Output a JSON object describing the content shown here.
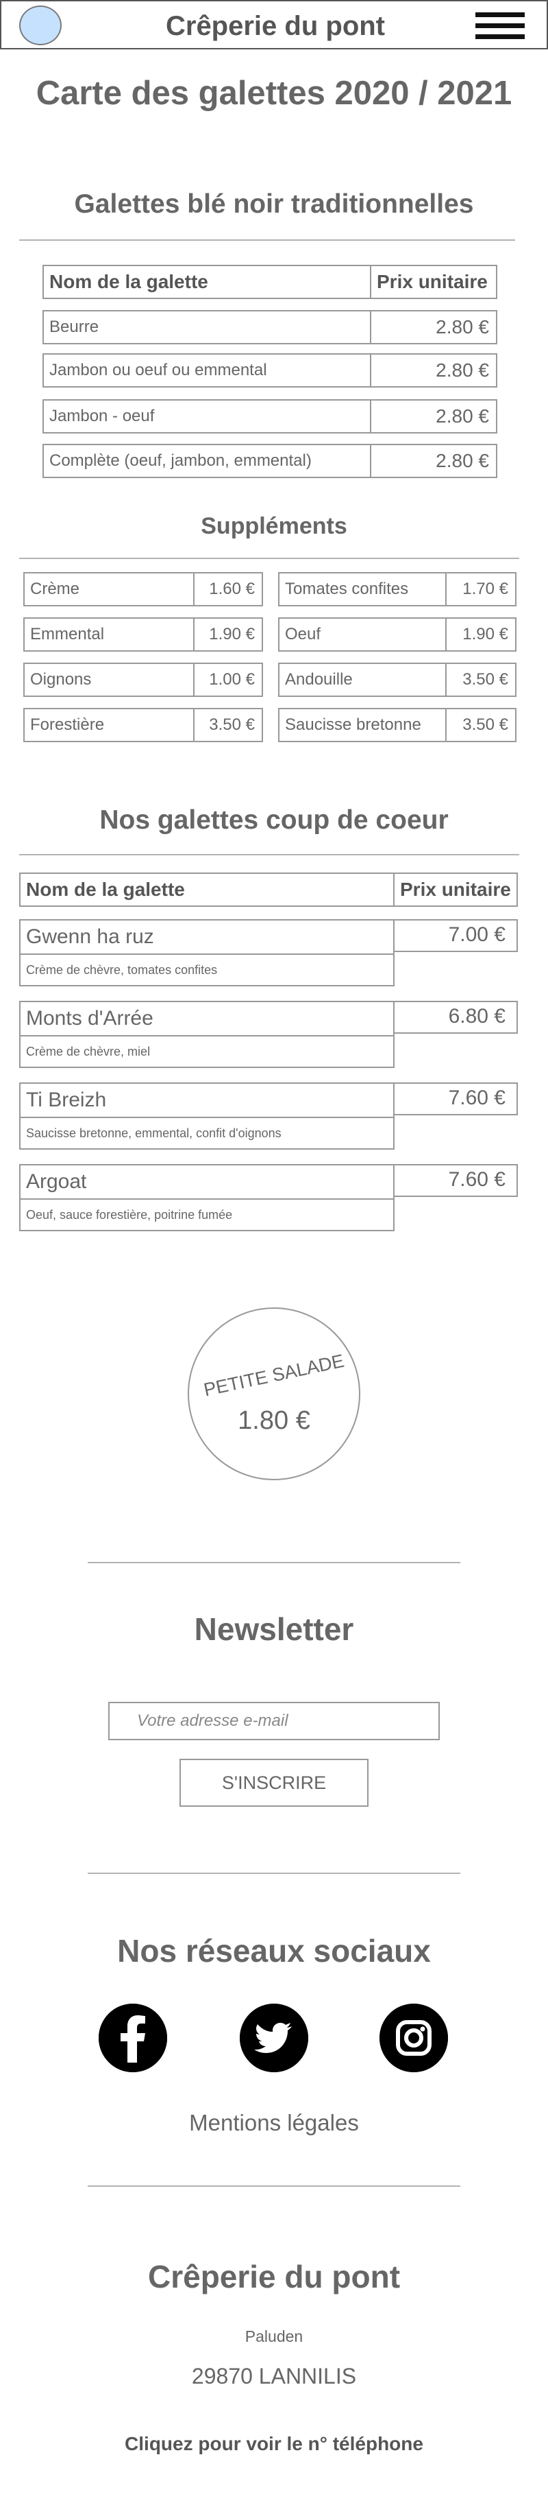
{
  "header": {
    "title": "Crêperie du pont"
  },
  "page_title": "Carte des galettes 2020 / 2021",
  "traditional": {
    "title": "Galettes blé noir traditionnelles",
    "col_name": "Nom de la galette",
    "col_price": "Prix unitaire",
    "rows": [
      {
        "name": "Beurre",
        "price": "2.80 €"
      },
      {
        "name": "Jambon ou oeuf ou emmental",
        "price": "2.80 €"
      },
      {
        "name": "Jambon - oeuf",
        "price": "2.80 €"
      },
      {
        "name": "Complète (oeuf, jambon, emmental)",
        "price": "2.80 €"
      }
    ]
  },
  "supplements": {
    "title": "Suppléments",
    "left": [
      {
        "name": "Crème",
        "price": "1.60 €"
      },
      {
        "name": "Emmental",
        "price": "1.90 €"
      },
      {
        "name": "Oignons",
        "price": "1.00 €"
      },
      {
        "name": "Forestière",
        "price": "3.50 €"
      }
    ],
    "right": [
      {
        "name": "Tomates confites",
        "price": "1.70 €"
      },
      {
        "name": "Oeuf",
        "price": "1.90 €"
      },
      {
        "name": "Andouille",
        "price": "3.50 €"
      },
      {
        "name": "Saucisse bretonne",
        "price": "3.50 €"
      }
    ]
  },
  "favorites": {
    "title": "Nos galettes coup de coeur",
    "col_name": "Nom de la galette",
    "col_price": "Prix unitaire",
    "rows": [
      {
        "name": "Gwenn ha ruz",
        "desc": "Crème de chèvre, tomates confites",
        "price": "7.00 €"
      },
      {
        "name": "Monts d'Arrée",
        "desc": "Crème de chèvre, miel",
        "price": "6.80 €"
      },
      {
        "name": "Ti Breizh",
        "desc": "Saucisse bretonne, emmental, confit d'oignons",
        "price": "7.60 €"
      },
      {
        "name": "Argoat",
        "desc": "Oeuf, sauce forestière, poitrine fumée",
        "price": "7.60 €"
      }
    ]
  },
  "salad": {
    "title": "PETITE SALADE",
    "price": "1.80 €"
  },
  "newsletter": {
    "title": "Newsletter",
    "placeholder": "Votre adresse e-mail",
    "button": "S'INSCRIRE"
  },
  "social": {
    "title": "Nos réseaux sociaux",
    "icons": [
      "facebook-icon",
      "twitter-icon",
      "instagram-icon"
    ]
  },
  "legal": "Mentions légales",
  "footer": {
    "name": "Crêperie du pont",
    "town": "Paluden",
    "city": "29870 LANNILIS",
    "phone_link": "Cliquez pour voir le n° téléphone"
  },
  "colors": {
    "logo": "#c6e1fd",
    "text": "#666666",
    "border": "#999999"
  }
}
